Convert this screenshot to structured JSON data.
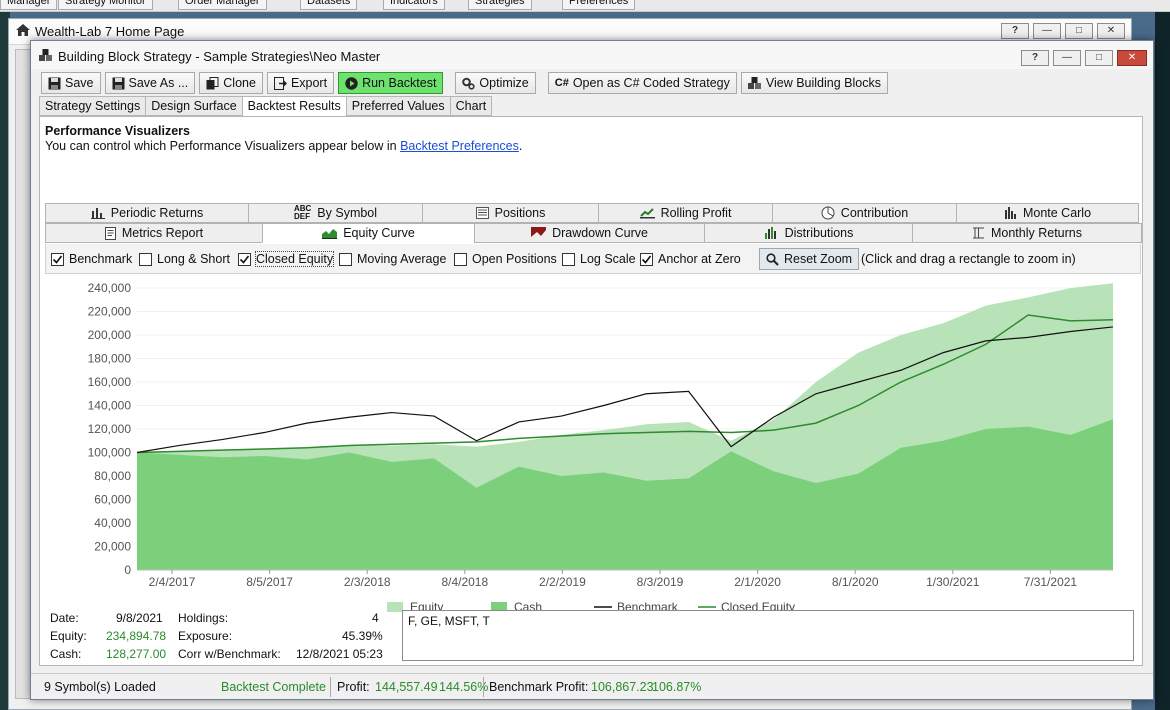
{
  "top_strip": [
    "Manager",
    "Strategy Monitor",
    "Order Manager",
    "Datasets",
    "Indicators",
    "Strategies",
    "Preferences"
  ],
  "home_window": {
    "title": "Wealth-Lab 7 Home Page"
  },
  "window": {
    "title": "Building Block Strategy - Sample Strategies\\Neo Master"
  },
  "window_buttons": {
    "help": "?",
    "minimize": "—",
    "maximize": "□",
    "close": "✕"
  },
  "toolbar": {
    "save": "Save",
    "save_as": "Save As ...",
    "clone": "Clone",
    "export": "Export",
    "run_backtest": "Run Backtest",
    "optimize": "Optimize",
    "open_csharp": "Open as C# Coded Strategy",
    "view_blocks": "View Building Blocks"
  },
  "tabs": [
    "Strategy Settings",
    "Design Surface",
    "Backtest Results",
    "Preferred Values",
    "Chart"
  ],
  "active_tab": "Backtest Results",
  "perf": {
    "title": "Performance Visualizers",
    "subtitle": "You can control which Performance Visualizers appear below in ",
    "link": "Backtest Preferences",
    "period": "."
  },
  "visualizer_tabs_row1": [
    "Periodic Returns",
    "By Symbol",
    "Positions",
    "Rolling Profit",
    "Contribution",
    "Monte Carlo"
  ],
  "visualizer_tabs_row2": [
    "Metrics Report",
    "Equity Curve",
    "Drawdown Curve",
    "Distributions",
    "Monthly Returns"
  ],
  "active_visualizer": "Equity Curve",
  "options": {
    "benchmark": {
      "label": "Benchmark",
      "checked": true
    },
    "long_short": {
      "label": "Long & Short",
      "checked": false
    },
    "closed_equity": {
      "label": "Closed Equity",
      "checked": true
    },
    "moving_average": {
      "label": "Moving Average",
      "checked": false
    },
    "open_positions": {
      "label": "Open Positions",
      "checked": false
    },
    "log_scale": {
      "label": "Log Scale",
      "checked": false
    },
    "anchor_zero": {
      "label": "Anchor at Zero",
      "checked": true
    }
  },
  "reset_zoom": "Reset Zoom",
  "zoom_hint": "(Click and drag a rectangle to zoom in)",
  "chart_data": {
    "type": "area",
    "x_ticks": [
      "2/4/2017",
      "8/5/2017",
      "2/3/2018",
      "8/4/2018",
      "2/2/2019",
      "8/3/2019",
      "2/1/2020",
      "8/1/2020",
      "1/30/2021",
      "7/31/2021"
    ],
    "y_ticks": [
      "240,000",
      "220,000",
      "200,000",
      "180,000",
      "160,000",
      "140,000",
      "120,000",
      "100,000",
      "80,000",
      "60,000",
      "40,000",
      "20,000",
      "0"
    ],
    "ylim": [
      0,
      240000
    ],
    "x": [
      "2017-01",
      "2017-04",
      "2017-07",
      "2017-10",
      "2018-01",
      "2018-04",
      "2018-07",
      "2018-10",
      "2019-01",
      "2019-04",
      "2019-07",
      "2019-10",
      "2020-01",
      "2020-02",
      "2020-03",
      "2020-04",
      "2020-07",
      "2020-10",
      "2021-01",
      "2021-04",
      "2021-07",
      "2021-09",
      "2021-11",
      "2021-12"
    ],
    "series": [
      {
        "name": "Equity",
        "values": [
          100000,
          101000,
          102000,
          103000,
          104000,
          106000,
          106000,
          107000,
          105000,
          109000,
          115000,
          119000,
          124000,
          126000,
          110000,
          128000,
          160000,
          185000,
          200000,
          210000,
          225000,
          232000,
          240000,
          244000
        ]
      },
      {
        "name": "Cash",
        "values": [
          100000,
          98000,
          96000,
          97000,
          94000,
          100000,
          92000,
          95000,
          70000,
          88000,
          80000,
          83000,
          76000,
          78000,
          101000,
          84000,
          74000,
          82000,
          104000,
          110000,
          120000,
          122000,
          115000,
          128277
        ]
      },
      {
        "name": "Benchmark",
        "values": [
          100000,
          106000,
          111000,
          117000,
          125000,
          130000,
          134000,
          131000,
          110000,
          126000,
          131000,
          140000,
          150000,
          152000,
          105000,
          130000,
          150000,
          160000,
          170000,
          185000,
          195000,
          198000,
          203000,
          206867
        ]
      },
      {
        "name": "Closed Equity",
        "values": [
          100000,
          101000,
          102000,
          103000,
          104000,
          106000,
          107000,
          108000,
          109000,
          112000,
          114000,
          116000,
          117000,
          118000,
          117000,
          119000,
          125000,
          140000,
          160000,
          175000,
          192000,
          217000,
          212000,
          213000
        ]
      }
    ],
    "legend": [
      "Equity",
      "Cash",
      "Benchmark",
      "Closed Equity"
    ],
    "colors": {
      "Equity": "#b8e3b8",
      "Cash": "#7cd07c",
      "Benchmark": "#111111",
      "Closed Equity": "#2e8b2e"
    }
  },
  "stats": {
    "date_label": "Date:",
    "date": "9/8/2021",
    "equity_label": "Equity:",
    "equity": "234,894.78",
    "cash_label": "Cash:",
    "cash": "128,277.00",
    "holdings_label": "Holdings:",
    "holdings": "4",
    "exposure_label": "Exposure:",
    "exposure": "45.39%",
    "corr_label": "Corr w/Benchmark:",
    "corr": "12/8/2021 05:23",
    "holdings_list": "F, GE, MSFT, T"
  },
  "status": {
    "symbols": "9 Symbol(s) Loaded",
    "state": "Backtest Complete",
    "profit_label": "Profit:",
    "profit": "144,557.49",
    "profit_pct": "144.56%",
    "bench_label": "Benchmark Profit:",
    "bench": "106,867.23",
    "bench_pct": "106.87%"
  }
}
